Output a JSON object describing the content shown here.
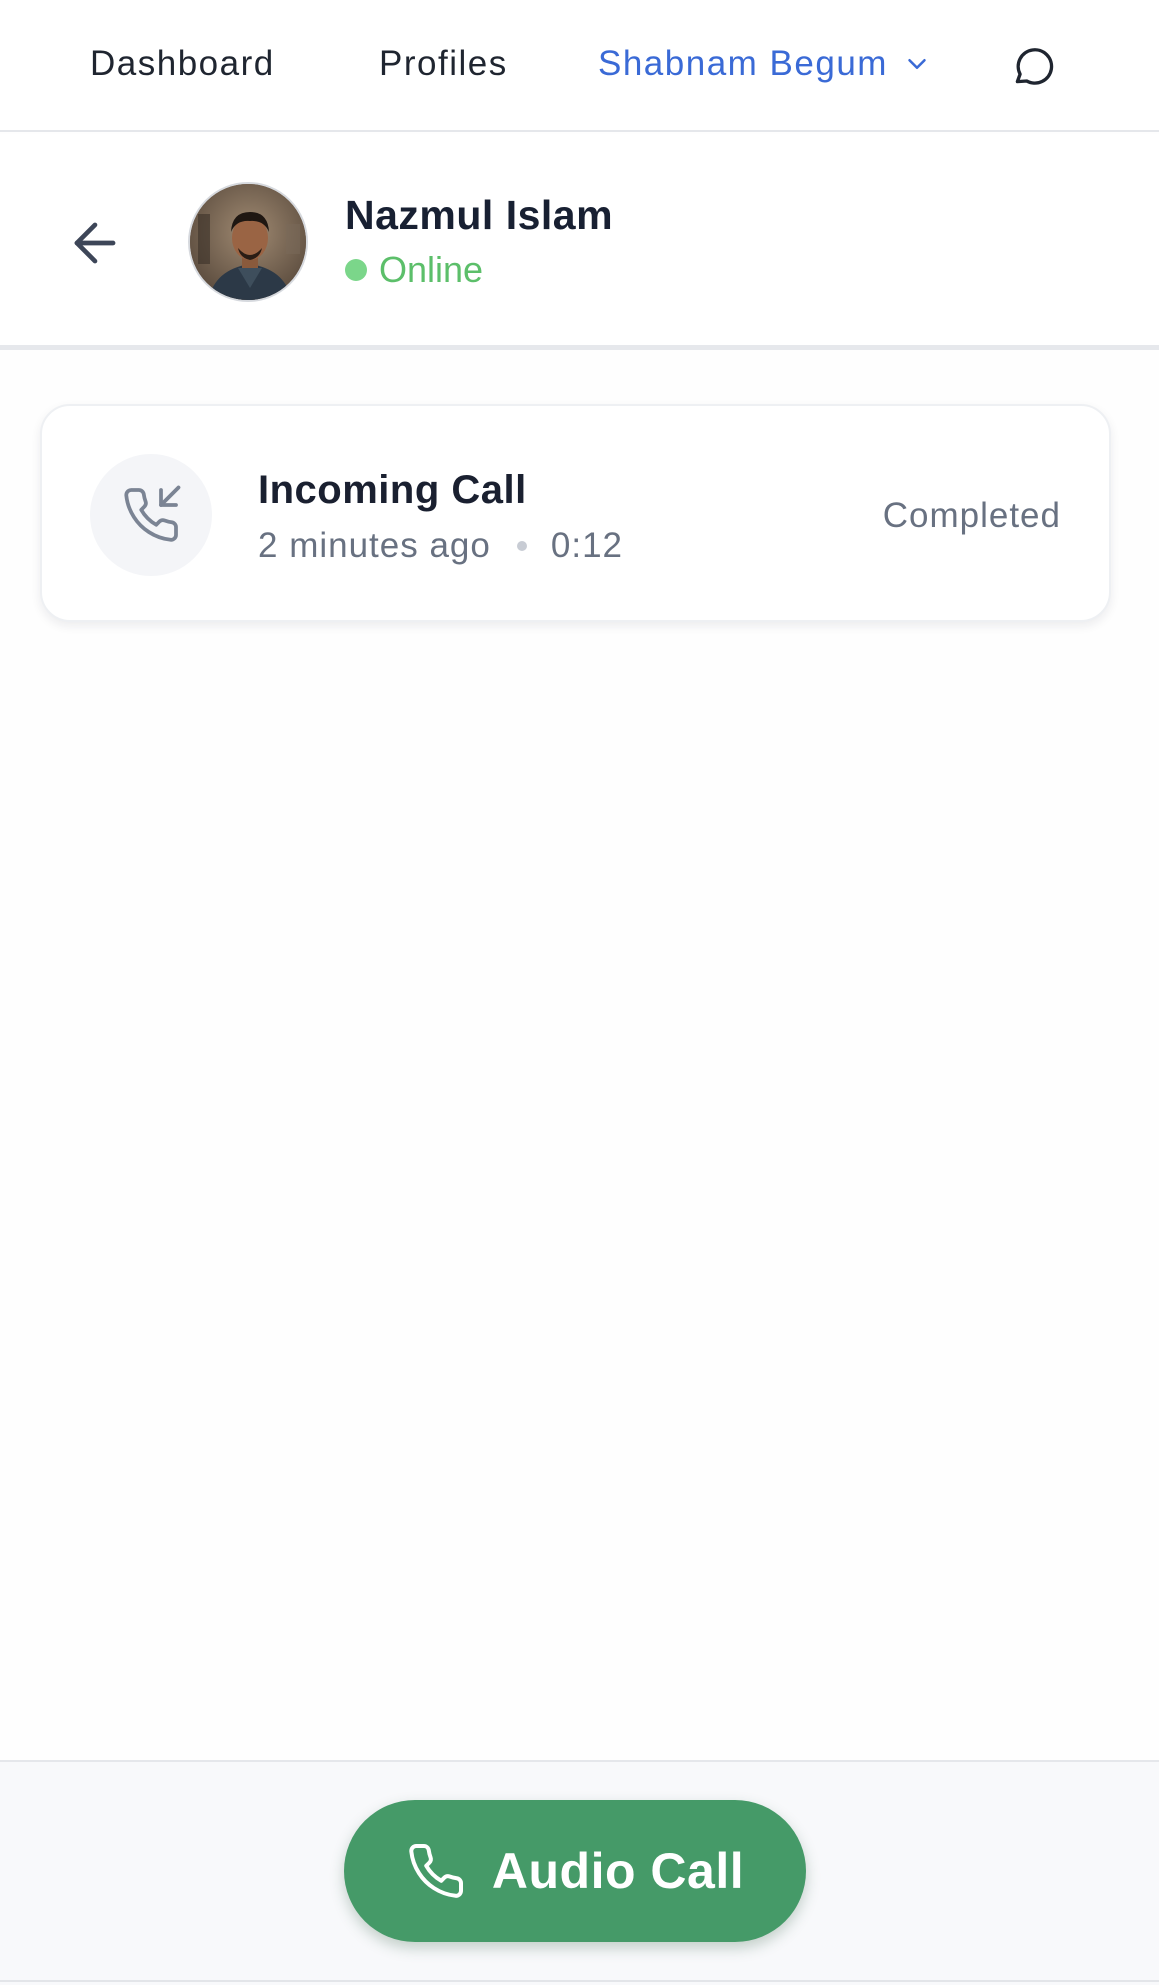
{
  "nav": {
    "dashboard_label": "Dashboard",
    "profiles_label": "Profiles",
    "user_name": "Shabnam Begum",
    "icons": {
      "user_menu": "chevron-down-icon",
      "messages": "message-circle-icon"
    }
  },
  "contact": {
    "name": "Nazmul Islam",
    "status": "Online",
    "status_color": "#5cbf6a",
    "icons": {
      "back": "arrow-left-icon",
      "avatar": "avatar"
    }
  },
  "calls": [
    {
      "title": "Incoming Call",
      "time_ago": "2 minutes ago",
      "duration": "0:12",
      "status": "Completed",
      "icon": "phone-incoming-icon"
    }
  ],
  "actions": {
    "audio_call_label": "Audio Call",
    "audio_call_color": "#459a68",
    "icon": "phone-icon"
  },
  "colors": {
    "accent": "#3a6ad6",
    "text_primary": "#1a2030",
    "text_secondary": "#687181"
  }
}
